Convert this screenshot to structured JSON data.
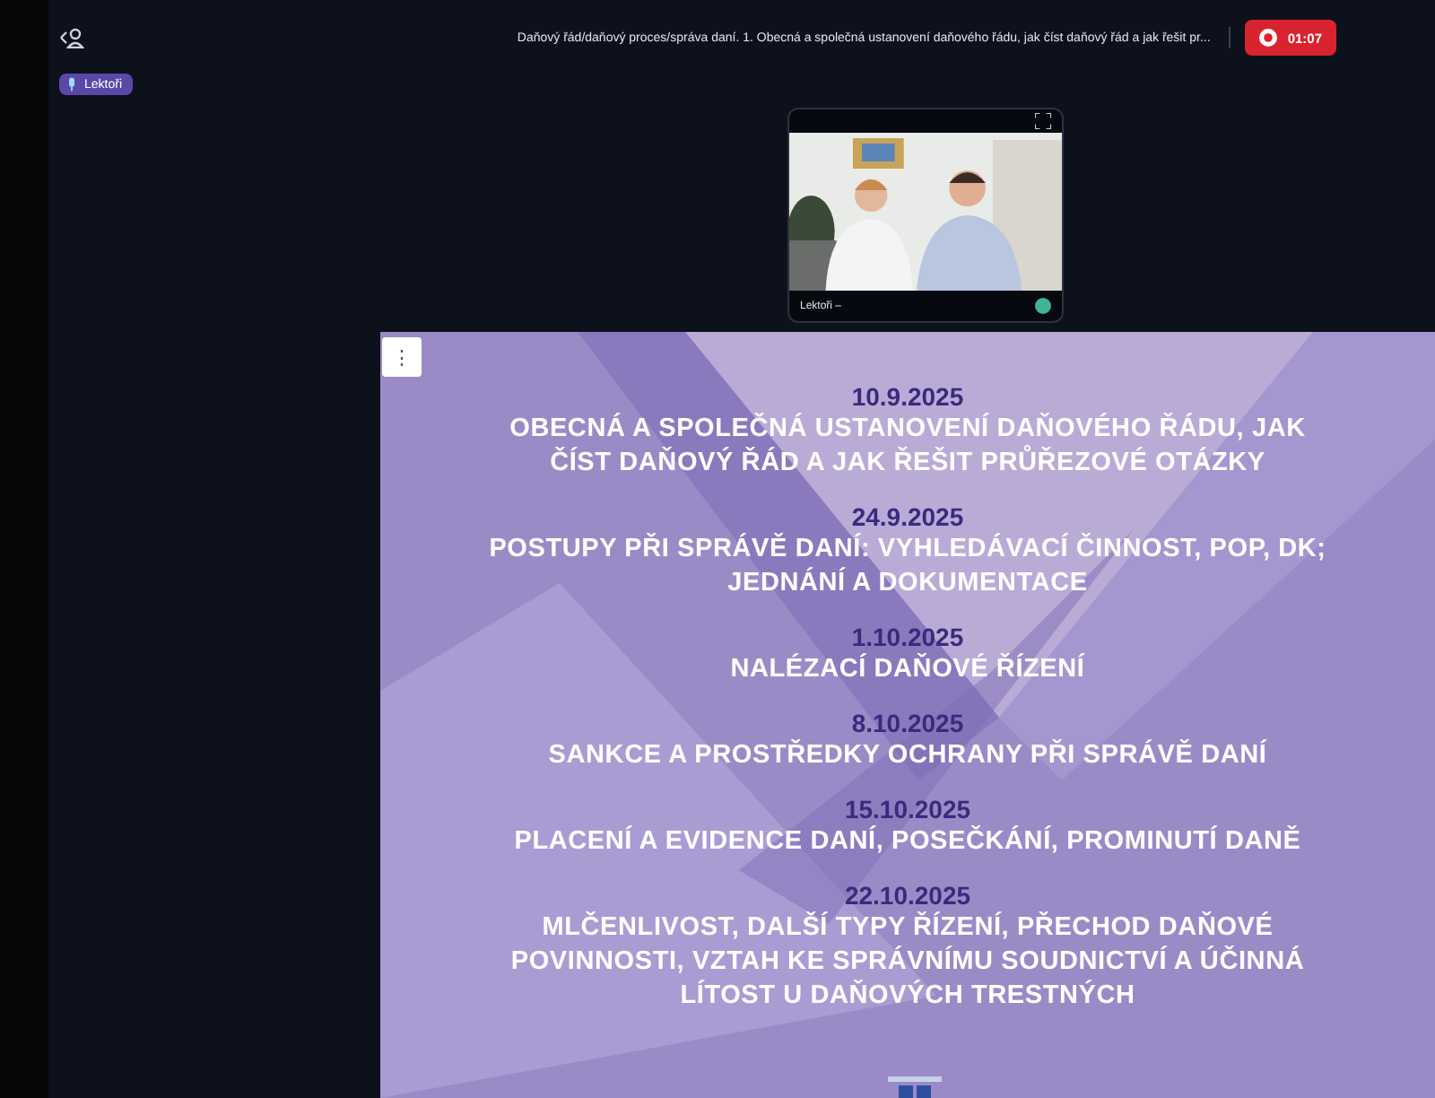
{
  "header": {
    "title": "Daňový řád/daňový proces/správa daní. 1. Obecná a společná ustanovení daňového řádu, jak číst daňový řád a jak řešit pr...",
    "timer": "01:07",
    "role_badge": "Lektoři"
  },
  "video_tile": {
    "label": "Lektoři –",
    "kind": "picture"
  },
  "slide": {
    "menu_glyph": "⋮",
    "items": [
      {
        "date": "10.9.2025",
        "title": "OBECNÁ A SPOLEČNÁ USTANOVENÍ DAŇOVÉHO ŘÁDU, JAK ČÍST DAŇOVÝ ŘÁD A JAK ŘEŠIT PRŮŘEZOVÉ OTÁZKY"
      },
      {
        "date": "24.9.2025",
        "title": "POSTUPY PŘI SPRÁVĚ DANÍ: VYHLEDÁVACÍ ČINNOST, POP, DK; JEDNÁNÍ A DOKUMENTACE"
      },
      {
        "date": "1.10.2025",
        "title": "NALÉZACÍ DAŇOVÉ ŘÍZENÍ"
      },
      {
        "date": "8.10.2025",
        "title": "SANKCE A PROSTŘEDKY OCHRANY PŘI SPRÁVĚ DANÍ"
      },
      {
        "date": "15.10.2025",
        "title": "PLACENÍ A EVIDENCE DANÍ, POSEČKÁNÍ, PROMINUTÍ DANĚ"
      },
      {
        "date": "22.10.2025",
        "title": "MLČENLIVOST, DALŠÍ TYPY ŘÍZENÍ, PŘECHOD DAŇOVÉ POVINNOSTI, VZTAH KE SPRÁVNÍMU SOUDNICTVÍ A ÚČINNÁ LÍTOST U DAŇOVÝCH TRESTNÝCH"
      }
    ]
  }
}
